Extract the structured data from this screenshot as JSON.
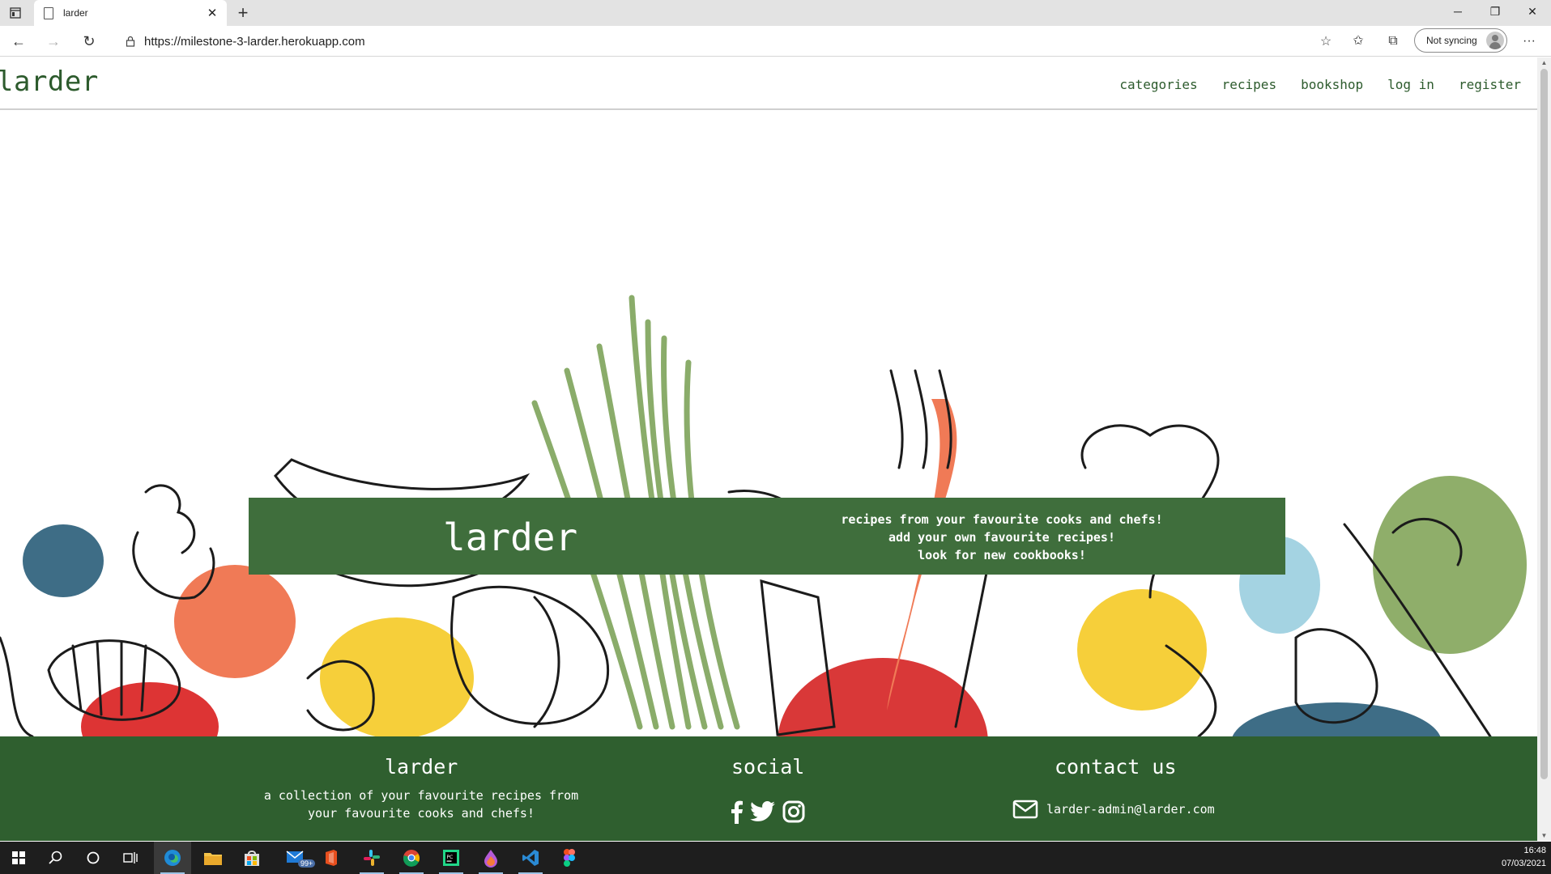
{
  "browser": {
    "tab_title": "larder",
    "url": "https://milestone-3-larder.herokuapp.com",
    "sync_label": "Not syncing"
  },
  "site": {
    "brand": "larder",
    "nav": [
      "categories",
      "recipes",
      "bookshop",
      "log in",
      "register"
    ]
  },
  "hero": {
    "title": "larder",
    "taglines": [
      "recipes from your favourite cooks and chefs!",
      "add your own favourite recipes!",
      "look for new cookbooks!"
    ]
  },
  "footer": {
    "about_title": "larder",
    "about_text_line1": "a collection of your favourite recipes from",
    "about_text_line2": "your favourite cooks and chefs!",
    "social_title": "social",
    "contact_title": "contact us",
    "contact_email": "larder-admin@larder.com"
  },
  "taskbar": {
    "mail_badge": "99+",
    "time": "16:48",
    "date": "07/03/2021"
  },
  "colors": {
    "brand_green": "#2d5b2d",
    "banner_green": "#3f6e3c",
    "footer_green": "#2f5f2f"
  }
}
